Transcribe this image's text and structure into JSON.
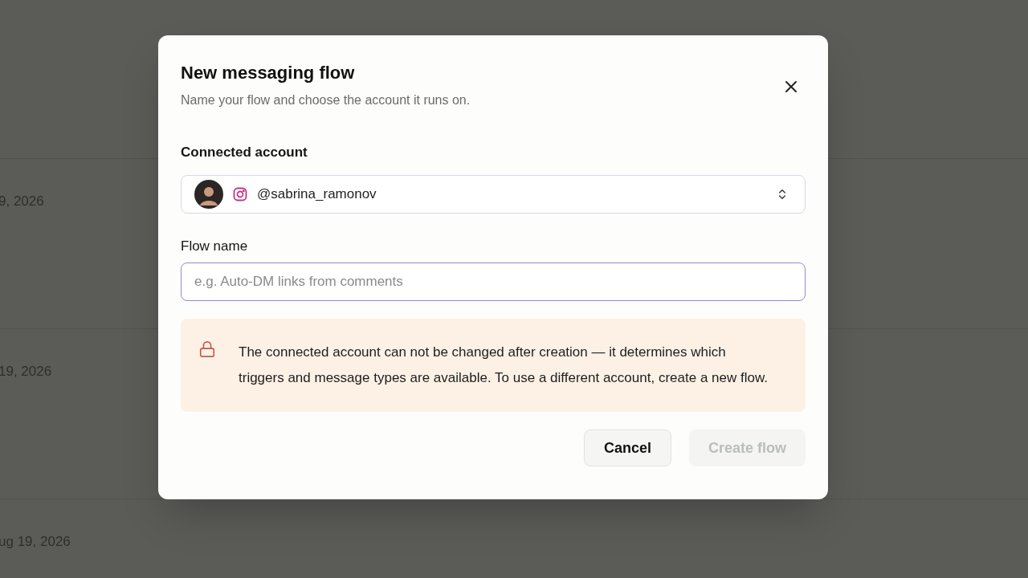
{
  "background_rows": [
    {
      "date": "9, 2026"
    },
    {
      "date": "19, 2026"
    },
    {
      "date": "ug 19, 2026"
    }
  ],
  "dialog": {
    "title": "New messaging flow",
    "subtitle": "Name your flow and choose the account it runs on.",
    "account_label": "Connected account",
    "account": {
      "handle": "@sabrina_ramonov"
    },
    "name_label": "Flow name",
    "name_placeholder": "e.g. Auto-DM links from comments",
    "notice": "The connected account can not be changed after creation — it determines which triggers and message types are available. To use a different account, create a new flow.",
    "buttons": [
      {
        "label": "Cancel",
        "disabled": false
      },
      {
        "label": "Create flow",
        "disabled": true
      }
    ]
  }
}
